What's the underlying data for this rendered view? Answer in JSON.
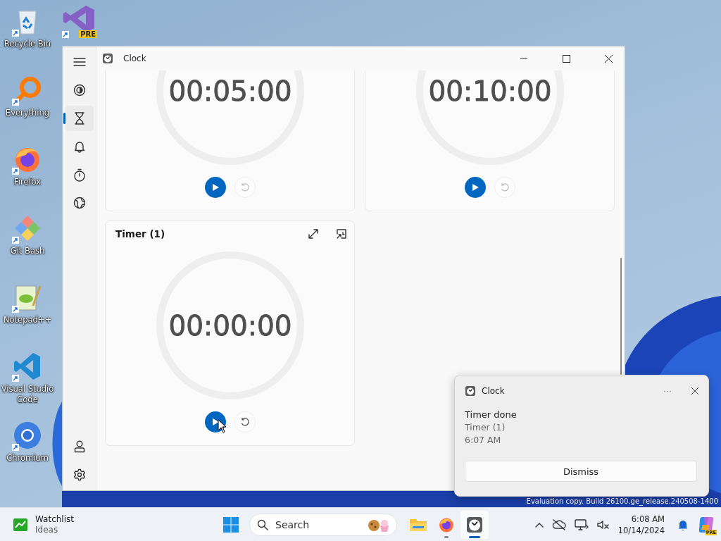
{
  "desktop": {
    "icons": [
      {
        "kind": "recycle-bin",
        "label": "Recycle Bin"
      },
      {
        "kind": "everything",
        "label": "Everything"
      },
      {
        "kind": "firefox",
        "label": "Firefox"
      },
      {
        "kind": "git-bash",
        "label": "Git Bash"
      },
      {
        "kind": "notepadpp",
        "label": "Notepad++"
      },
      {
        "kind": "vscode",
        "label": "Visual Studio Code"
      },
      {
        "kind": "chromium",
        "label": "Chromium"
      }
    ],
    "partial_icon": {
      "kind": "vs-preview",
      "badge": "PRE"
    },
    "watermark": "Evaluation copy. Build 26100.ge_release.240508-1400"
  },
  "window": {
    "title": "Clock",
    "nav": [
      {
        "kind": "focus",
        "selected": false
      },
      {
        "kind": "timer",
        "selected": true
      },
      {
        "kind": "alarm",
        "selected": false
      },
      {
        "kind": "stopwatch",
        "selected": false
      },
      {
        "kind": "world",
        "selected": false
      }
    ],
    "nav_bottom": [
      {
        "kind": "account"
      },
      {
        "kind": "settings"
      }
    ],
    "timers": [
      {
        "time": "00:05:00"
      },
      {
        "time": "00:10:00"
      },
      {
        "title": "Timer (1)",
        "time": "00:00:00"
      }
    ]
  },
  "notification": {
    "app": "Clock",
    "title": "Timer done",
    "lines": [
      "Timer (1)",
      "6:07 AM"
    ],
    "more": "···",
    "button": "Dismiss"
  },
  "taskbar": {
    "widget": {
      "title": "Watchlist",
      "subtitle": "Ideas"
    },
    "search": {
      "placeholder": "Search"
    },
    "apps": [
      {
        "kind": "explorer",
        "running": false,
        "selected": false
      },
      {
        "kind": "firefox",
        "running": true,
        "selected": false
      },
      {
        "kind": "clock",
        "running": true,
        "selected": true
      }
    ],
    "tray": [
      {
        "kind": "chevron"
      },
      {
        "kind": "cloud-off"
      },
      {
        "kind": "network"
      },
      {
        "kind": "volume-muted"
      }
    ],
    "time": "6:08 AM",
    "date": "10/14/2024",
    "copilot_badge": "PRE"
  }
}
